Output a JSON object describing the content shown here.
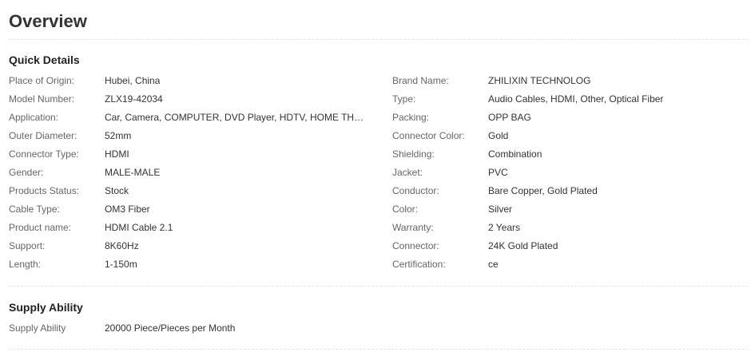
{
  "page_title": "Overview",
  "quick_details": {
    "title": "Quick Details",
    "left": [
      {
        "label": "Place of Origin:",
        "value": "Hubei, China"
      },
      {
        "label": "Model Number:",
        "value": "ZLX19-42034"
      },
      {
        "label": "Application:",
        "value": "Car, Camera, COMPUTER, DVD Player, HDTV, HOME THEATE..."
      },
      {
        "label": "Outer Diameter:",
        "value": "52mm"
      },
      {
        "label": "Connector Type:",
        "value": "HDMI"
      },
      {
        "label": "Gender:",
        "value": "MALE-MALE"
      },
      {
        "label": "Products Status:",
        "value": "Stock"
      },
      {
        "label": "Cable Type:",
        "value": "OM3 Fiber"
      },
      {
        "label": "Product name:",
        "value": "HDMI Cable 2.1"
      },
      {
        "label": "Support:",
        "value": "8K60Hz"
      },
      {
        "label": "Length:",
        "value": "1-150m"
      }
    ],
    "right": [
      {
        "label": "Brand Name:",
        "value": "ZHILIXIN TECHNOLOG"
      },
      {
        "label": "Type:",
        "value": "Audio Cables, HDMI, Other, Optical Fiber"
      },
      {
        "label": "Packing:",
        "value": "OPP BAG"
      },
      {
        "label": "Connector Color:",
        "value": "Gold"
      },
      {
        "label": "Shielding:",
        "value": "Combination"
      },
      {
        "label": "Jacket:",
        "value": "PVC"
      },
      {
        "label": "Conductor:",
        "value": "Bare Copper, Gold Plated"
      },
      {
        "label": "Color:",
        "value": "Silver"
      },
      {
        "label": "Warranty:",
        "value": "2 Years"
      },
      {
        "label": "Connector:",
        "value": "24K Gold Plated"
      },
      {
        "label": "Certification:",
        "value": "ce"
      }
    ]
  },
  "supply_ability": {
    "title": "Supply Ability",
    "rows": [
      {
        "label": "Supply Ability",
        "value": "20000 Piece/Pieces per Month"
      }
    ]
  }
}
